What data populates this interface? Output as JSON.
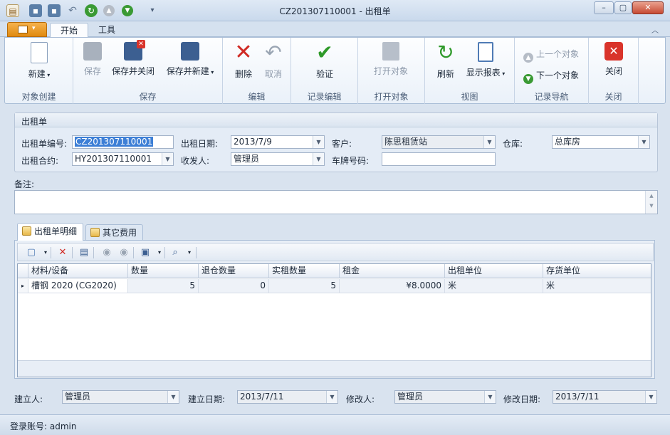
{
  "window": {
    "title": "CZ201307110001 - 出租单"
  },
  "ribbon_tabs": [
    {
      "label": "开始"
    },
    {
      "label": "工具"
    }
  ],
  "ribbon": {
    "groups": [
      {
        "label": "对象创建"
      },
      {
        "label": "保存"
      },
      {
        "label": "编辑"
      },
      {
        "label": "记录编辑"
      },
      {
        "label": "打开对象"
      },
      {
        "label": "视图"
      },
      {
        "label": "记录导航"
      },
      {
        "label": "关闭"
      }
    ],
    "buttons": {
      "new": "新建",
      "save": "保存",
      "save_close": "保存并关闭",
      "save_new": "保存并新建",
      "delete": "删除",
      "cancel": "取消",
      "verify": "验证",
      "open_object": "打开对象",
      "refresh": "刷新",
      "show_report": "显示报表",
      "prev": "上一个对象",
      "next": "下一个对象",
      "close": "关闭"
    }
  },
  "form": {
    "group_title": "出租单",
    "labels": {
      "order_no": "出租单编号:",
      "date": "出租日期:",
      "customer": "客户:",
      "warehouse": "仓库:",
      "contract": "出租合约:",
      "sender": "收发人:",
      "plate": "车牌号码:"
    },
    "values": {
      "order_no": "CZ201307110001",
      "date": "2013/7/9",
      "customer": "陈思租赁站",
      "warehouse": "总库房",
      "contract": "HY201307110001",
      "sender": "管理员",
      "plate": ""
    },
    "note_label": "备注:"
  },
  "detail_tabs": [
    {
      "label": "出租单明细"
    },
    {
      "label": "其它费用"
    }
  ],
  "grid": {
    "columns": [
      "材料/设备",
      "数量",
      "退仓数量",
      "实租数量",
      "租金",
      "出租单位",
      "存货单位"
    ],
    "rows": [
      [
        "槽钢 2020 (CG2020)",
        "5",
        "0",
        "5",
        "¥8.0000",
        "米",
        "米"
      ]
    ]
  },
  "footer": {
    "labels": {
      "creator": "建立人:",
      "created": "建立日期:",
      "modifier": "修改人:",
      "modified": "修改日期:"
    },
    "values": {
      "creator": "管理员",
      "created": "2013/7/11",
      "modifier": "管理员",
      "modified": "2013/7/11"
    }
  },
  "status": {
    "login": "登录账号: admin"
  }
}
